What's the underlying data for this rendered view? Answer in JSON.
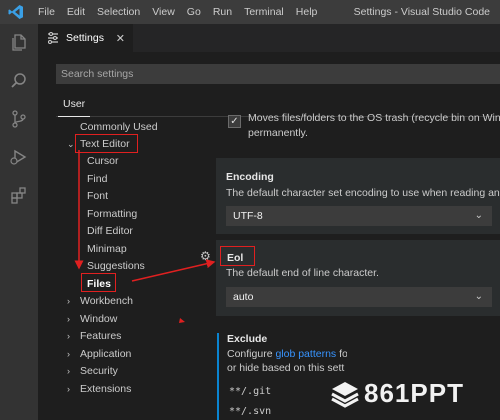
{
  "menu": {
    "items": [
      "File",
      "Edit",
      "Selection",
      "View",
      "Go",
      "Run",
      "Terminal",
      "Help"
    ],
    "window_title": "Settings - Visual Studio Code"
  },
  "activity_bar": {
    "icons": [
      "files-icon",
      "search-icon",
      "source-control-icon",
      "run-debug-icon",
      "extensions-icon"
    ]
  },
  "tab": {
    "label": "Settings",
    "close": "✕"
  },
  "search": {
    "placeholder": "Search settings"
  },
  "scope_tab": {
    "label": "User"
  },
  "tree": {
    "commonly_used": "Commonly Used",
    "text_editor": "Text Editor",
    "text_editor_children": [
      "Cursor",
      "Find",
      "Font",
      "Formatting",
      "Diff Editor",
      "Minimap",
      "Suggestions",
      "Files"
    ],
    "sections": [
      "Workbench",
      "Window",
      "Features",
      "Application",
      "Security",
      "Extensions"
    ]
  },
  "settings": {
    "trash": {
      "text1": "Moves files/folders to the OS trash (recycle bin on Wind",
      "text2": "permanently.",
      "checked": true
    },
    "encoding": {
      "title": "Encoding",
      "desc": "The default character set encoding to use when reading and",
      "value": "UTF-8"
    },
    "eol": {
      "title": "Eol",
      "desc": "The default end of line character.",
      "value": "auto"
    },
    "exclude": {
      "title": "Exclude",
      "desc_pre": "Configure ",
      "link": "glob patterns",
      "desc_post": " fo",
      "desc2": "or hide based on this setti",
      "patterns": [
        "**/.git",
        "**/.svn"
      ]
    }
  },
  "watermark": {
    "text": "861PPT"
  },
  "colors": {
    "accent": "#0a84d0",
    "annotation_red": "#e02020",
    "link": "#3794ff"
  }
}
